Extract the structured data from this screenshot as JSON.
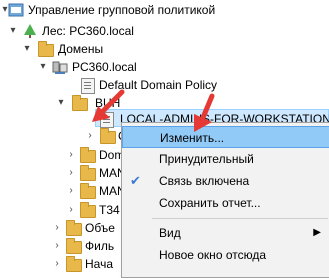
{
  "tree": {
    "root": "Управление групповой политикой",
    "forest": "Лес: PC360.local",
    "domains": "Домены",
    "domain": "PC360.local",
    "default_policy": "Default Domain Policy",
    "buh": "BUH",
    "gpo_link": "LOCAL-ADMINS-FOR-WORKSTATIONS",
    "c_item": "C",
    "dom_item": "Dom",
    "man1": "MAN",
    "man2": "MAN",
    "t34": "T34",
    "obj": "Объе",
    "fil": "Филь",
    "nach": "Нача"
  },
  "context_menu": {
    "edit": "Изменить...",
    "enforced": "Принудительный",
    "link_enabled": "Связь включена",
    "save_report": "Сохранить отчет...",
    "view": "Вид",
    "new_window": "Новое окно отсюда",
    "link_enabled_checked": true
  },
  "colors": {
    "selection": "#cde8ff",
    "menu_highlight": "#91c9f7",
    "annotation_arrow": "#e53935"
  }
}
